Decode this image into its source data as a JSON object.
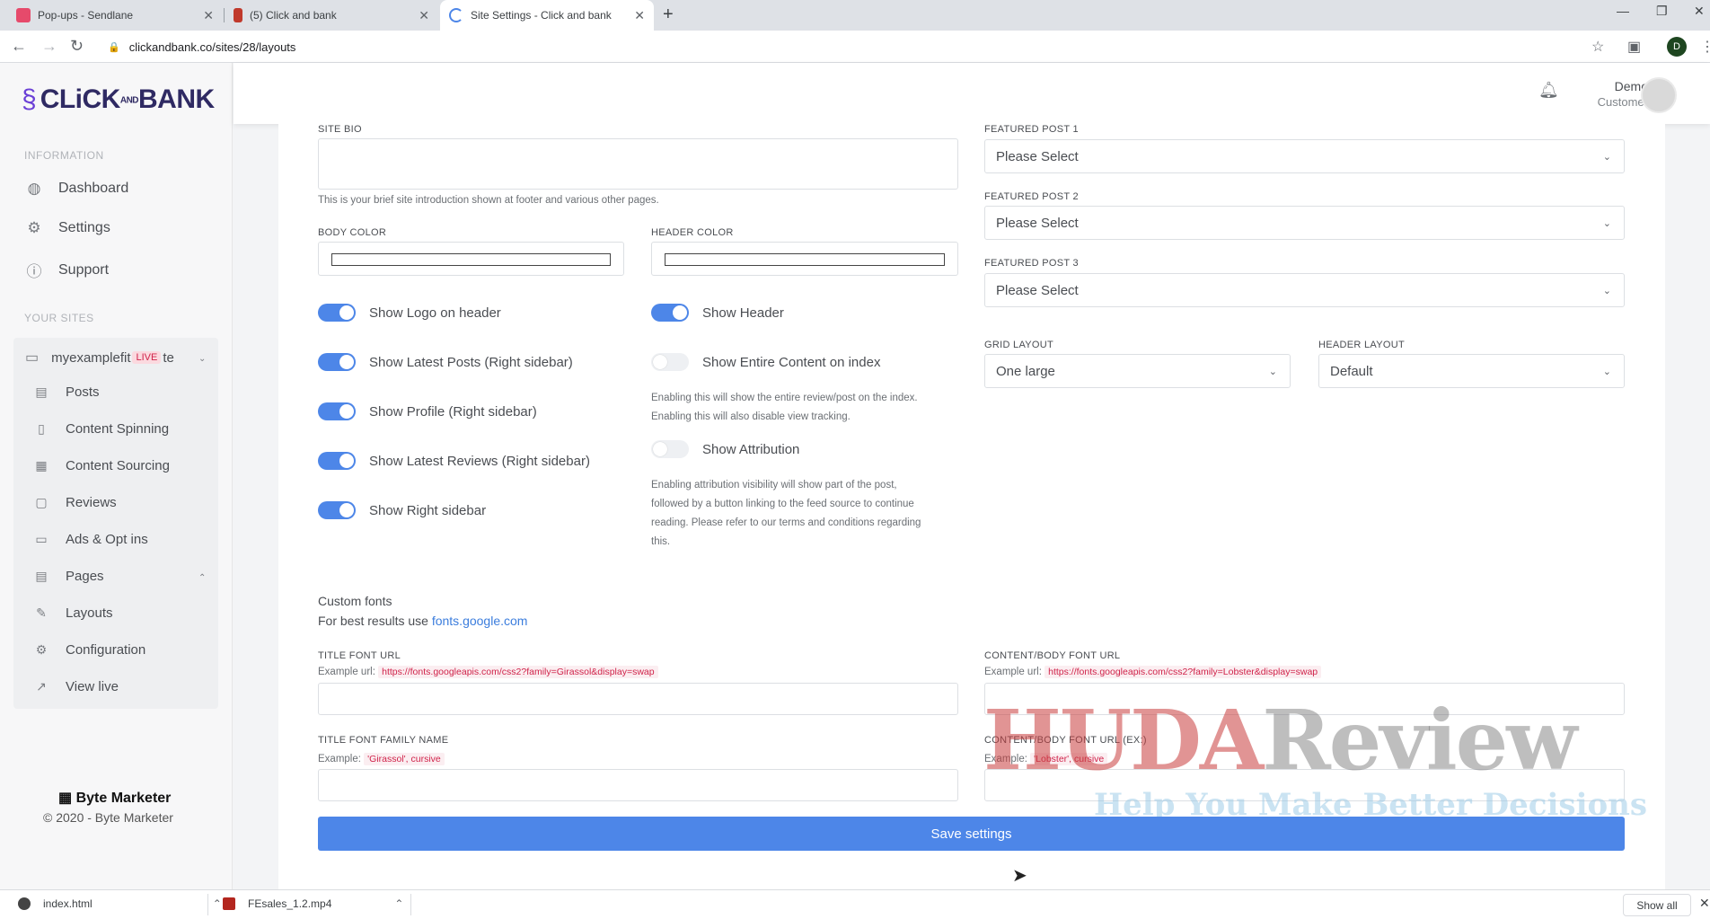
{
  "browser": {
    "tabs": [
      {
        "title": "Pop-ups - Sendlane"
      },
      {
        "title": "(5) Click and bank"
      },
      {
        "title": "Site Settings - Click and bank"
      }
    ],
    "url": "clickandbank.co/sites/28/layouts",
    "profile_initial": "D"
  },
  "sidebar": {
    "logo_text": "CLiCK",
    "logo_and": "AND",
    "logo_bank": "BANK",
    "section_information": "INFORMATION",
    "info_items": [
      {
        "label": "Dashboard",
        "icon": "globe-icon"
      },
      {
        "label": "Settings",
        "icon": "gear-icon"
      },
      {
        "label": "Support",
        "icon": "help-icon"
      }
    ],
    "section_sites": "YOUR SITES",
    "site_name": "myexamplefit",
    "site_badge": "LIVE",
    "site_suffix": "te",
    "site_items": [
      {
        "label": "Posts"
      },
      {
        "label": "Content Spinning"
      },
      {
        "label": "Content Sourcing"
      },
      {
        "label": "Reviews"
      },
      {
        "label": "Ads & Opt ins"
      },
      {
        "label": "Pages"
      },
      {
        "label": "Layouts"
      },
      {
        "label": "Configuration"
      },
      {
        "label": "View live"
      }
    ],
    "footer_brand": "Byte Marketer",
    "footer_copy": "© 2020 - Byte Marketer"
  },
  "header": {
    "user_name": "Demo",
    "user_role": "Customer"
  },
  "form": {
    "site_bio_label": "SITE BIO",
    "site_bio_help": "This is your brief site introduction shown at footer and various other pages.",
    "body_color_label": "BODY COLOR",
    "header_color_label": "HEADER COLOR",
    "toggles_left": [
      {
        "label": "Show Logo on header",
        "on": true
      },
      {
        "label": "Show Latest Posts (Right sidebar)",
        "on": true
      },
      {
        "label": "Show Profile (Right sidebar)",
        "on": true
      },
      {
        "label": "Show Latest Reviews (Right sidebar)",
        "on": true
      },
      {
        "label": "Show Right sidebar",
        "on": true
      }
    ],
    "toggle_show_header": "Show Header",
    "toggle_entire_content": "Show Entire Content on index",
    "entire_content_help_1": "Enabling this will show the entire review/post on the index.",
    "entire_content_help_2": "Enabling this will also disable view tracking.",
    "toggle_attribution": "Show Attribution",
    "attribution_help_1": "Enabling attribution visibility will show part of the post,",
    "attribution_help_2": "followed by a button linking to the feed source to continue",
    "attribution_help_3": "reading. Please refer to our terms and conditions regarding",
    "attribution_help_4": "this.",
    "featured_1_label": "FEATURED POST 1",
    "featured_2_label": "FEATURED POST 2",
    "featured_3_label": "FEATURED POST 3",
    "featured_placeholder": "Please Select",
    "grid_layout_label": "GRID LAYOUT",
    "grid_layout_value": "One large",
    "header_layout_label": "HEADER LAYOUT",
    "header_layout_value": "Default",
    "custom_fonts_title": "Custom fonts",
    "custom_fonts_prefix": "For best results use",
    "custom_fonts_link": "fonts.google.com",
    "title_font_url_label": "TITLE FONT URL",
    "example_url_prefix": "Example url:",
    "title_font_url_example": "https://fonts.googleapis.com/css2?family=Girassol&display=swap",
    "content_font_url_label": "CONTENT/BODY FONT URL",
    "content_font_url_example": "https://fonts.googleapis.com/css2?family=Lobster&display=swap",
    "title_font_family_label": "TITLE FONT FAMILY NAME",
    "example_prefix": "Example:",
    "title_font_family_example": "'Girassol', cursive",
    "content_font_family_label": "CONTENT/BODY FONT URL (EX:)",
    "content_font_family_example": "'Lobster', cursive",
    "save_label": "Save settings"
  },
  "watermark": {
    "main_red": "HUDA",
    "main_grey": "Review",
    "sub": "Help You Make Better Decisions"
  },
  "downloads": {
    "items": [
      {
        "name": "index.html"
      },
      {
        "name": "FEsales_1.2.mp4"
      }
    ],
    "show_all": "Show all"
  },
  "colors": {
    "accent": "#4d86e8",
    "brand": "#2f2a63",
    "badge": "#d0234a"
  }
}
